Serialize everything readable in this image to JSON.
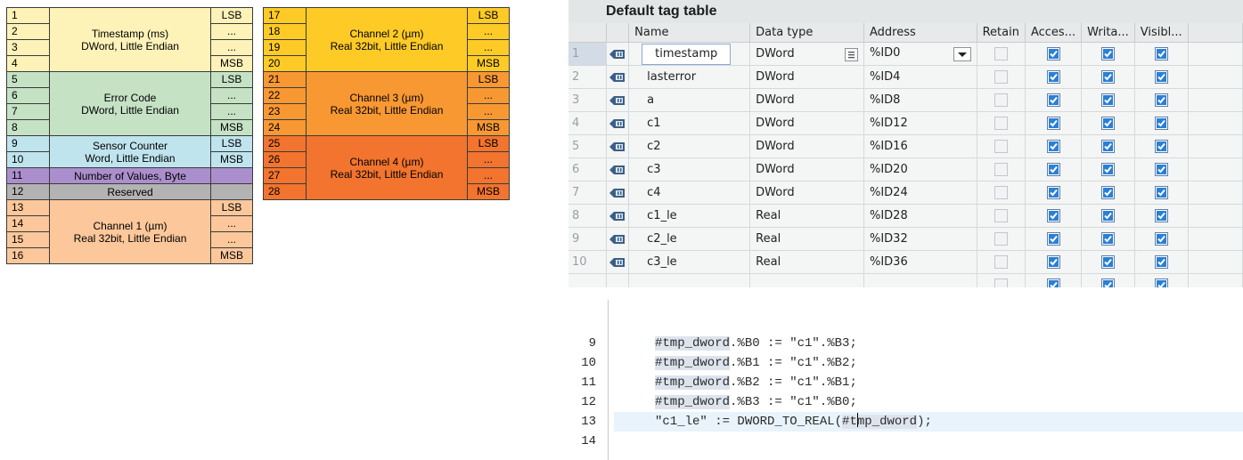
{
  "byte_tables": {
    "left": {
      "rows": [
        "1",
        "2",
        "3",
        "4",
        "5",
        "6",
        "7",
        "8",
        "9",
        "10",
        "11",
        "12",
        "13",
        "14",
        "15",
        "16"
      ],
      "sides": [
        "LSB",
        "...",
        "...",
        "MSB",
        "LSB",
        "...",
        "...",
        "MSB",
        "LSB",
        "MSB",
        "",
        "",
        "LSB",
        "...",
        "...",
        "MSB"
      ],
      "groups": [
        {
          "line1": "Timestamp (ms)",
          "line2": "DWord, Little Endian",
          "color": "#fdf2b8"
        },
        {
          "line1": "Error Code",
          "line2": "DWord, Little Endian",
          "color": "#c5e2c5"
        },
        {
          "line1": "Sensor Counter",
          "line2": "Word, Little Endian",
          "color": "#bfe4ee"
        },
        {
          "line1": "Number of Values, Byte",
          "color": "#ab8fcd"
        },
        {
          "line1": "Reserved",
          "color": "#b3b3b3"
        },
        {
          "line1": "Channel 1 (µm)",
          "line2": "Real 32bit, Little Endian",
          "color": "#fcc79a"
        }
      ]
    },
    "right": {
      "rows": [
        "17",
        "18",
        "19",
        "20",
        "21",
        "22",
        "23",
        "24",
        "25",
        "26",
        "27",
        "28"
      ],
      "sides": [
        "LSB",
        "...",
        "...",
        "MSB",
        "LSB",
        "...",
        "...",
        "MSB",
        "LSB",
        "...",
        "...",
        "MSB"
      ],
      "groups": [
        {
          "line1": "Channel 2 (µm)",
          "line2": "Real 32bit, Little Endian",
          "color": "#fecb26"
        },
        {
          "line1": "Channel 3 (µm)",
          "line2": "Real 32bit, Little Endian",
          "color": "#f89833"
        },
        {
          "line1": "Channel 4 (µm)",
          "line2": "Real 32bit, Little Endian",
          "color": "#f2742e"
        }
      ]
    }
  },
  "tag_table": {
    "title": "Default tag table",
    "headers": {
      "name": "Name",
      "data_type": "Data type",
      "address": "Address",
      "retain": "Retain",
      "access": "Acces...",
      "write": "Writa...",
      "visible": "Visibl..."
    },
    "rows": [
      {
        "num": "1",
        "name": "timestamp",
        "type": "DWord",
        "address": "%ID0"
      },
      {
        "num": "2",
        "name": "lasterror",
        "type": "DWord",
        "address": "%ID4"
      },
      {
        "num": "3",
        "name": "a",
        "type": "DWord",
        "address": "%ID8"
      },
      {
        "num": "4",
        "name": "c1",
        "type": "DWord",
        "address": "%ID12"
      },
      {
        "num": "5",
        "name": "c2",
        "type": "DWord",
        "address": "%ID16"
      },
      {
        "num": "6",
        "name": "c3",
        "type": "DWord",
        "address": "%ID20"
      },
      {
        "num": "7",
        "name": "c4",
        "type": "DWord",
        "address": "%ID24"
      },
      {
        "num": "8",
        "name": "c1_le",
        "type": "Real",
        "address": "%ID28"
      },
      {
        "num": "9",
        "name": "c2_le",
        "type": "Real",
        "address": "%ID32"
      },
      {
        "num": "10",
        "name": "c3_le",
        "type": "Real",
        "address": "%ID36"
      }
    ]
  },
  "code": {
    "lines": [
      {
        "num": "9",
        "var": "#tmp_dword",
        "rest": ".%B0 := \"c1\".%B3;"
      },
      {
        "num": "10",
        "var": "#tmp_dword",
        "rest": ".%B1 := \"c1\".%B2;"
      },
      {
        "num": "11",
        "var": "#tmp_dword",
        "rest": ".%B2 := \"c1\".%B1;"
      },
      {
        "num": "12",
        "var": "#tmp_dword",
        "rest": ".%B3 := \"c1\".%B0;"
      }
    ],
    "line13": {
      "num": "13",
      "pre": "\"c1_le\" := DWORD_TO_REAL(",
      "arg_a": "#t",
      "arg_b": "mp_dword",
      "post": ");"
    },
    "line14": {
      "num": "14"
    }
  }
}
